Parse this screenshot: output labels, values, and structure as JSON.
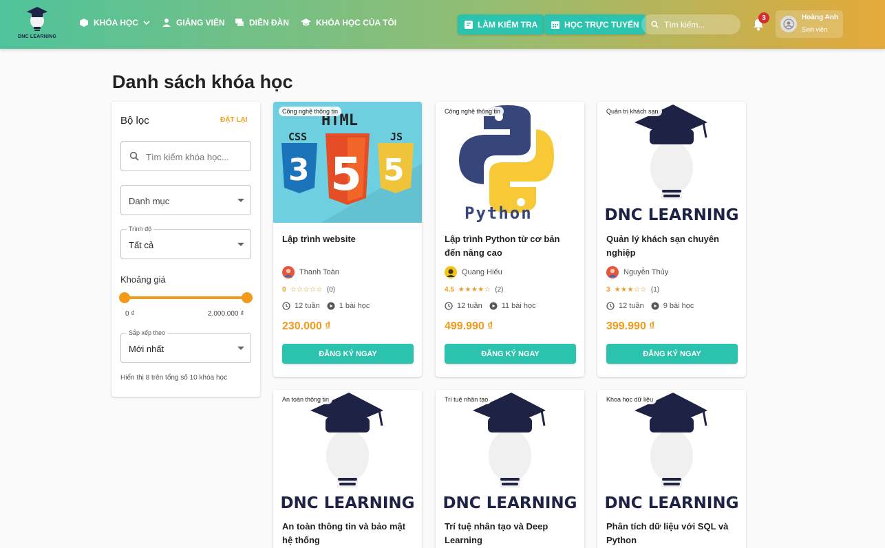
{
  "header": {
    "logo_text": "DNC LEARNING",
    "nav": [
      {
        "label": "KHÓA HỌC"
      },
      {
        "label": "GIẢNG VIÊN"
      },
      {
        "label": "DIỄN ĐÀN"
      },
      {
        "label": "KHÓA HỌC CỦA TÔI"
      }
    ],
    "buttons": {
      "quiz": "LÀM KIỂM TRA",
      "online": "HỌC TRỰC TUYẾN"
    },
    "search_placeholder": "Tìm kiếm...",
    "notification_count": "3",
    "user": {
      "name": "Hoàng Anh",
      "role": "Sinh viên"
    }
  },
  "page_title": "Danh sách khóa học",
  "filter": {
    "title": "Bộ lọc",
    "reset": "ĐẶT LẠI",
    "search_placeholder": "Tìm kiếm khóa học...",
    "category_placeholder": "Danh mục",
    "level_label": "Trình độ",
    "level_value": "Tất cả",
    "price_label": "Khoảng giá",
    "price_min": "0 ₫",
    "price_max": "2.000.000 ₫",
    "sort_label": "Sắp xếp theo",
    "sort_value": "Mới nhất",
    "count_text": "Hiển thị 8 trên tổng số 10 khóa học"
  },
  "courses": [
    {
      "category": "Công nghệ thông tin",
      "title": "Lập trình website",
      "instructor": "Thanh Toàn",
      "rating": "0",
      "stars": "☆☆☆☆☆",
      "reviews": "(0)",
      "duration": "12 tuần",
      "lessons": "1 bài học",
      "price": "230.000 ₫",
      "cta": "ĐĂNG KÝ NGAY"
    },
    {
      "category": "Công nghệ thông tin",
      "title": "Lập trình Python từ cơ bản đến nâng cao",
      "instructor": "Quang Hiếu",
      "rating": "4.5",
      "stars": "★★★★☆",
      "reviews": "(2)",
      "duration": "12 tuần",
      "lessons": "11 bài học",
      "price": "499.990 ₫",
      "cta": "ĐĂNG KÝ NGAY"
    },
    {
      "category": "Quản trị khách sạn",
      "title": "Quản lý khách sạn chuyên nghiệp",
      "instructor": "Nguyễn Thủy",
      "rating": "3",
      "stars": "★★★☆☆",
      "reviews": "(1)",
      "duration": "12 tuần",
      "lessons": "9 bài học",
      "price": "399.990 ₫",
      "cta": "ĐĂNG KÝ NGAY"
    },
    {
      "category": "An toàn thông tin",
      "title": "An toàn thông tin và bảo mật hệ thống"
    },
    {
      "category": "Trí tuệ nhân tạo",
      "title": "Trí tuệ nhân tạo và Deep Learning"
    },
    {
      "category": "Khoa học dữ liệu",
      "title": "Phân tích dữ liệu với SQL và Python"
    }
  ],
  "thumb_text": {
    "html": "HTML",
    "css": "CSS",
    "js": "JS",
    "python": "Python",
    "brand": "DNC LEARNING"
  },
  "colors": {
    "accent": "#2bc3ae",
    "price": "#f29a1a",
    "navy": "#1e2345"
  }
}
